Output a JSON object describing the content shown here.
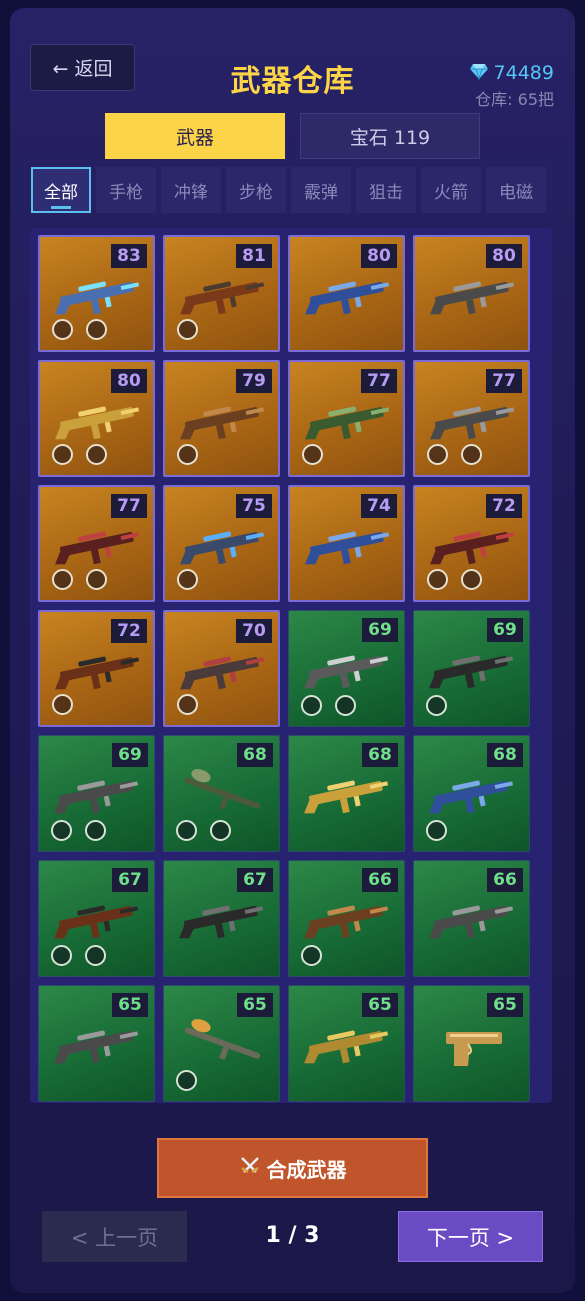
{
  "header": {
    "back_label": "← 返回",
    "title": "武器仓库",
    "gems": "74489",
    "storage": "仓库: 65把"
  },
  "main_tabs": [
    "武器",
    "宝石 119"
  ],
  "sub_tabs": [
    "全部",
    "手枪",
    "冲锋",
    "步枪",
    "霰弹",
    "狙击",
    "火箭",
    "电磁"
  ],
  "active_sub_tab": "全部",
  "colors": {
    "gold_rarity": "#b0691a",
    "green_rarity": "#1b7338",
    "accent": "#fbd448",
    "gem": "#55c6f5"
  },
  "weapons": [
    {
      "level": "83",
      "rarity": "gold",
      "icon": "plasma-rifle-icon",
      "slots": 2
    },
    {
      "level": "81",
      "rarity": "gold",
      "icon": "shotgun-icon",
      "slots": 1
    },
    {
      "level": "80",
      "rarity": "gold",
      "icon": "blue-smg-icon",
      "slots": 0
    },
    {
      "level": "80",
      "rarity": "gold",
      "icon": "sniper-rifle-icon",
      "slots": 0
    },
    {
      "level": "80",
      "rarity": "gold",
      "icon": "golden-rifle-icon",
      "slots": 2
    },
    {
      "level": "79",
      "rarity": "gold",
      "icon": "bronze-shotgun-icon",
      "slots": 1
    },
    {
      "level": "77",
      "rarity": "gold",
      "icon": "green-sniper-icon",
      "slots": 1
    },
    {
      "level": "77",
      "rarity": "gold",
      "icon": "sniper-rifle-icon",
      "slots": 2
    },
    {
      "level": "77",
      "rarity": "gold",
      "icon": "red-shotgun-icon",
      "slots": 2
    },
    {
      "level": "75",
      "rarity": "gold",
      "icon": "blue-assault-rifle-icon",
      "slots": 1
    },
    {
      "level": "74",
      "rarity": "gold",
      "icon": "blue-smg-icon",
      "slots": 0
    },
    {
      "level": "72",
      "rarity": "gold",
      "icon": "red-shotgun-icon",
      "slots": 2
    },
    {
      "level": "72",
      "rarity": "gold",
      "icon": "ak-rifle-icon",
      "slots": 1
    },
    {
      "level": "70",
      "rarity": "gold",
      "icon": "scoped-rifle-icon",
      "slots": 1
    },
    {
      "level": "69",
      "rarity": "green",
      "icon": "smg-icon",
      "slots": 2
    },
    {
      "level": "69",
      "rarity": "green",
      "icon": "black-rifle-icon",
      "slots": 1
    },
    {
      "level": "69",
      "rarity": "green",
      "icon": "sniper-rifle-icon",
      "slots": 2
    },
    {
      "level": "68",
      "rarity": "green",
      "icon": "rocket-launcher-icon",
      "slots": 2
    },
    {
      "level": "68",
      "rarity": "green",
      "icon": "golden-rifle-icon",
      "slots": 0
    },
    {
      "level": "68",
      "rarity": "green",
      "icon": "blue-smg-icon",
      "slots": 1
    },
    {
      "level": "67",
      "rarity": "green",
      "icon": "ak-rifle-icon",
      "slots": 2
    },
    {
      "level": "67",
      "rarity": "green",
      "icon": "black-rifle-icon",
      "slots": 0
    },
    {
      "level": "66",
      "rarity": "green",
      "icon": "bronze-shotgun-icon",
      "slots": 1
    },
    {
      "level": "66",
      "rarity": "green",
      "icon": "sniper-rifle-icon",
      "slots": 0
    },
    {
      "level": "65",
      "rarity": "green",
      "icon": "sniper-rifle-icon",
      "slots": 0
    },
    {
      "level": "65",
      "rarity": "green",
      "icon": "rpg-launcher-icon",
      "slots": 1
    },
    {
      "level": "65",
      "rarity": "green",
      "icon": "golden-smg-icon",
      "slots": 0
    },
    {
      "level": "65",
      "rarity": "green",
      "icon": "golden-pistol-icon",
      "slots": 0
    }
  ],
  "footer": {
    "forge_label": "合成武器",
    "prev_label": "< 上一页",
    "page_indicator": "1 / 3",
    "next_label": "下一页 >"
  }
}
